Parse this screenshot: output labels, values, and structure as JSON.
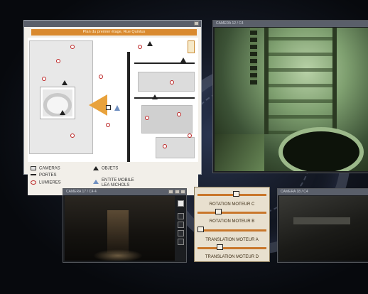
{
  "map_window": {
    "title": "Plan du premier étage, Rue Quintus",
    "legend": {
      "cameras": "CAMERAS",
      "portes": "PORTES",
      "lumieres": "LUMIERES",
      "objets": "OBJETS",
      "entite_line1": "ENTITE MOBILE",
      "entite_line2": "LEA NICHOLS"
    }
  },
  "camera_top": {
    "title": "CAMERA 12 / C4"
  },
  "camera_bottom_left": {
    "title": "CAMERA 17 / C4 4"
  },
  "camera_bottom_right": {
    "title": "CAMERA 18 / C4"
  },
  "motor_panel": {
    "controls": [
      {
        "label": "ROTATION MOTEUR C",
        "position": 0.55
      },
      {
        "label": "ROTATION MOTEUR B",
        "position": 0.28
      },
      {
        "label": "TRANSLATION MOTEUR A",
        "position": 0.0
      },
      {
        "label": "TRANSLATION MOTEUR D",
        "position": 0.3
      }
    ]
  },
  "colors": {
    "accent": "#d9892e",
    "slider": "#c9772b",
    "camera_green": "#7fa070"
  }
}
